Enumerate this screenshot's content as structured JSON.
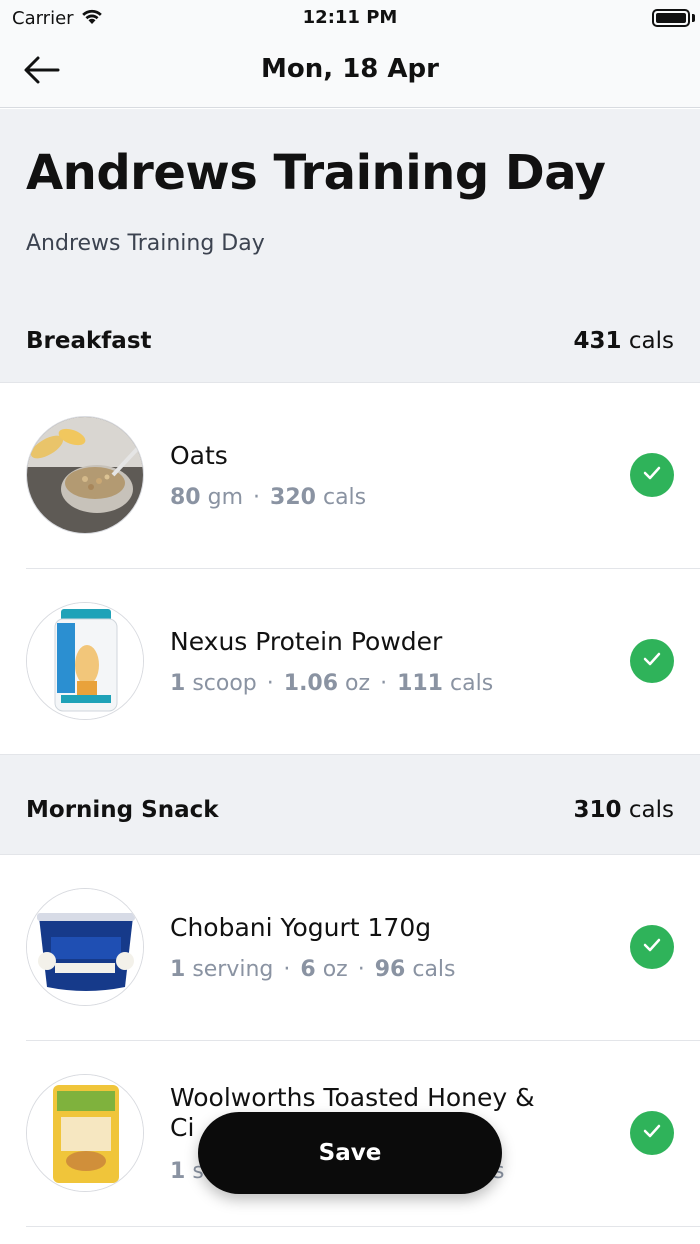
{
  "status_bar": {
    "carrier": "Carrier",
    "time": "12:11 PM"
  },
  "nav": {
    "title": "Mon, 18 Apr",
    "back_icon": "arrow-left-icon"
  },
  "plan": {
    "title": "Andrews Training Day",
    "subtitle": "Andrews Training Day"
  },
  "sections": [
    {
      "name": "Breakfast",
      "cals_value": "431",
      "cals_unit": "cals",
      "items": [
        {
          "name": "Oats",
          "qty1_num": "80",
          "qty1_unit": "gm",
          "qty2_num": "",
          "qty2_unit": "",
          "cals_num": "320",
          "cals_unit": "cals",
          "checked": true,
          "thumb": "oats-image"
        },
        {
          "name": "Nexus Protein Powder",
          "qty1_num": "1",
          "qty1_unit": "scoop",
          "qty2_num": "1.06",
          "qty2_unit": "oz",
          "cals_num": "111",
          "cals_unit": "cals",
          "checked": true,
          "thumb": "protein-powder-image"
        }
      ]
    },
    {
      "name": "Morning Snack",
      "cals_value": "310",
      "cals_unit": "cals",
      "items": [
        {
          "name": "Chobani Yogurt 170g",
          "qty1_num": "1",
          "qty1_unit": "serving",
          "qty2_num": "6",
          "qty2_unit": "oz",
          "cals_num": "96",
          "cals_unit": "cals",
          "checked": true,
          "thumb": "yogurt-image"
        },
        {
          "name_line1": "Woolworths Toasted Honey &",
          "name_line2": "Ci",
          "qty1_num": "1",
          "qty1_unit": "se",
          "cals_tail": "s",
          "checked": true,
          "thumb": "muesli-image"
        }
      ]
    }
  ],
  "save_label": "Save",
  "colors": {
    "accent_check": "#2fb35a",
    "save_bg": "#0b0b0b",
    "section_bg": "#eff1f4",
    "meta_text": "#8a93a2"
  }
}
